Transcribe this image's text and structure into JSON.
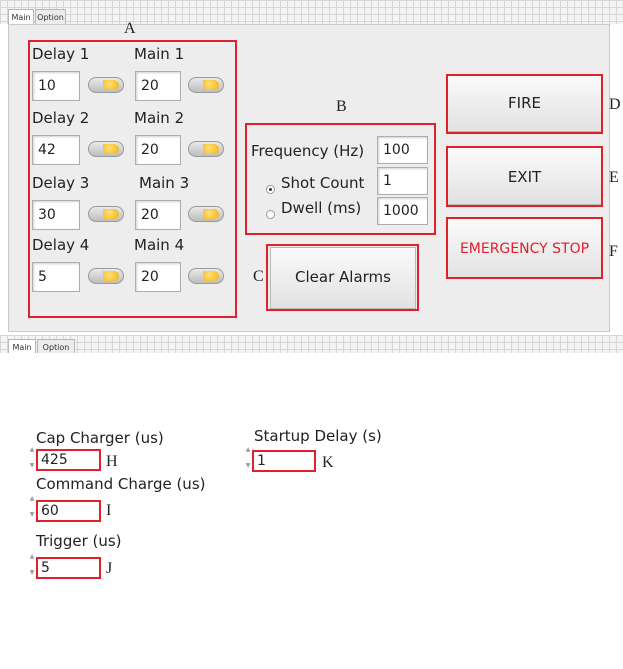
{
  "top": {
    "tabs": [
      {
        "label": "Main"
      },
      {
        "label": "Option"
      }
    ],
    "group_a": {
      "letter": "A",
      "rows": [
        {
          "delay_label": "Delay 1",
          "delay_value": "10",
          "main_label": "Main 1",
          "main_value": "20"
        },
        {
          "delay_label": "Delay 2",
          "delay_value": "42",
          "main_label": "Main 2",
          "main_value": "20"
        },
        {
          "delay_label": "Delay 3",
          "delay_value": "30",
          "main_label": "Main 3",
          "main_value": "20"
        },
        {
          "delay_label": "Delay 4",
          "delay_value": "5",
          "main_label": "Main 4",
          "main_value": "20"
        }
      ]
    },
    "group_b": {
      "letter": "B",
      "frequency_label": "Frequency (Hz)",
      "frequency_value": "100",
      "shot_count_label": "Shot Count",
      "shot_count_value": "1",
      "dwell_label": "Dwell  (ms)",
      "dwell_value": "1000",
      "selected_mode": "Shot Count"
    },
    "clear_alarms": {
      "label": "Clear Alarms",
      "letter": "C"
    },
    "fire": {
      "label": "FIRE",
      "letter": "D"
    },
    "exit": {
      "label": "EXIT",
      "letter": "E"
    },
    "emergency_stop": {
      "label": "EMERGENCY STOP",
      "letter": "F",
      "color": "#e0202a"
    }
  },
  "bottom": {
    "tabs": [
      {
        "label": "Main"
      },
      {
        "label": "Option"
      }
    ],
    "cap_charger": {
      "label": "Cap Charger (us)",
      "value": "425",
      "letter": "H"
    },
    "command_charge": {
      "label": "Command Charge (us)",
      "value": "60",
      "letter": "I"
    },
    "trigger": {
      "label": "Trigger (us)",
      "value": "5",
      "letter": "J"
    },
    "startup_delay": {
      "label": "Startup Delay (s)",
      "value": "1",
      "letter": "K"
    }
  },
  "colors": {
    "annotation_red": "#e0202a",
    "panel_gray": "#ededed"
  }
}
